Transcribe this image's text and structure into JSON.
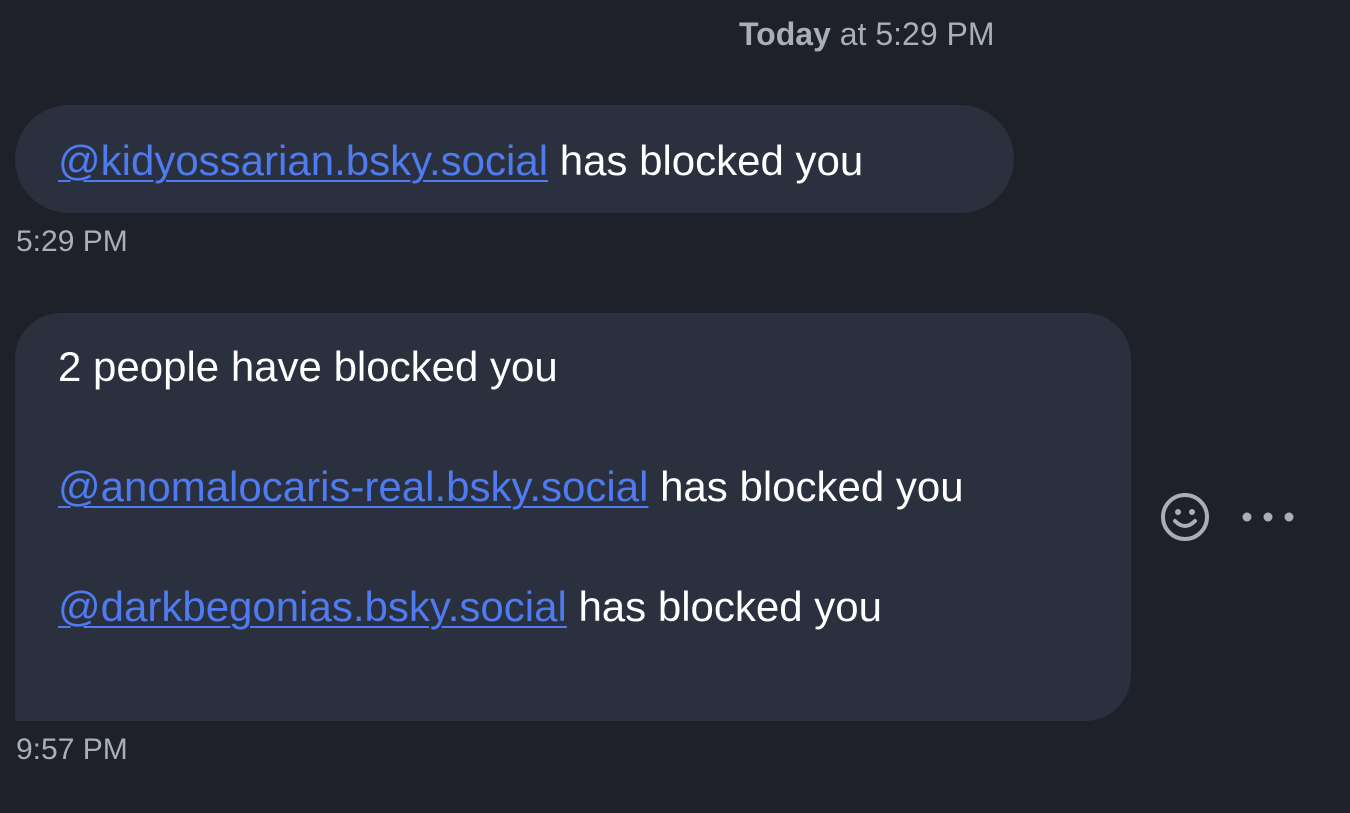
{
  "header": {
    "day": "Today",
    "time_text": " at 5:29 PM"
  },
  "messages": [
    {
      "mention": "@kidyossarian.bsky.social",
      "text": " has blocked you",
      "timestamp": "5:29 PM"
    },
    {
      "intro": "2 people have blocked you",
      "entries": [
        {
          "mention": "@anomalocaris-real.bsky.social",
          "text": " has blocked you"
        },
        {
          "mention": "@darkbegonias.bsky.social",
          "text": " has blocked you"
        }
      ],
      "timestamp": "9:57 PM"
    }
  ],
  "actions": {
    "emoji_icon": "smiley-icon",
    "more_icon": "ellipsis-icon"
  },
  "colors": {
    "background": "#1e2129",
    "bubble": "#2a303d",
    "link": "#4f7bf0",
    "muted": "#a9aebb"
  }
}
